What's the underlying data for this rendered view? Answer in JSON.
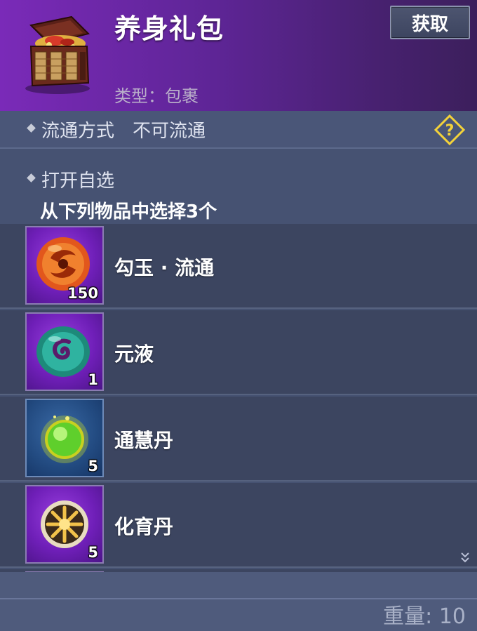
{
  "header": {
    "title": "养身礼包",
    "type_line": "类型：包裹",
    "obtain_label": "获取",
    "chest_icon": "treasure-chest-icon"
  },
  "circulation": {
    "label": "流通方式",
    "value": "不可流通",
    "help_icon": "question-diamond-icon"
  },
  "selection": {
    "label": "打开自选",
    "instruction": "从下列物品中选择3个"
  },
  "items": [
    {
      "name": "勾玉 · 流通",
      "qty": "150",
      "icon": "orange-magatama-icon",
      "rarity_color": "#7a2ec8"
    },
    {
      "name": "元液",
      "qty": "1",
      "icon": "teal-swirl-orb-icon",
      "rarity_color": "#7a2ec8"
    },
    {
      "name": "通慧丹",
      "qty": "5",
      "icon": "green-pill-orb-icon",
      "rarity_color": "#2a5a96"
    },
    {
      "name": "化育丹",
      "qty": "5",
      "icon": "golden-star-orb-icon",
      "rarity_color": "#7a2ec8"
    }
  ],
  "footer": {
    "weight_text": "重量: 10"
  },
  "colors": {
    "header_purple": "#6a28a8",
    "panel_bg": "#465272",
    "row_bg": "#3c4560",
    "help_yellow": "#f3d23a"
  }
}
